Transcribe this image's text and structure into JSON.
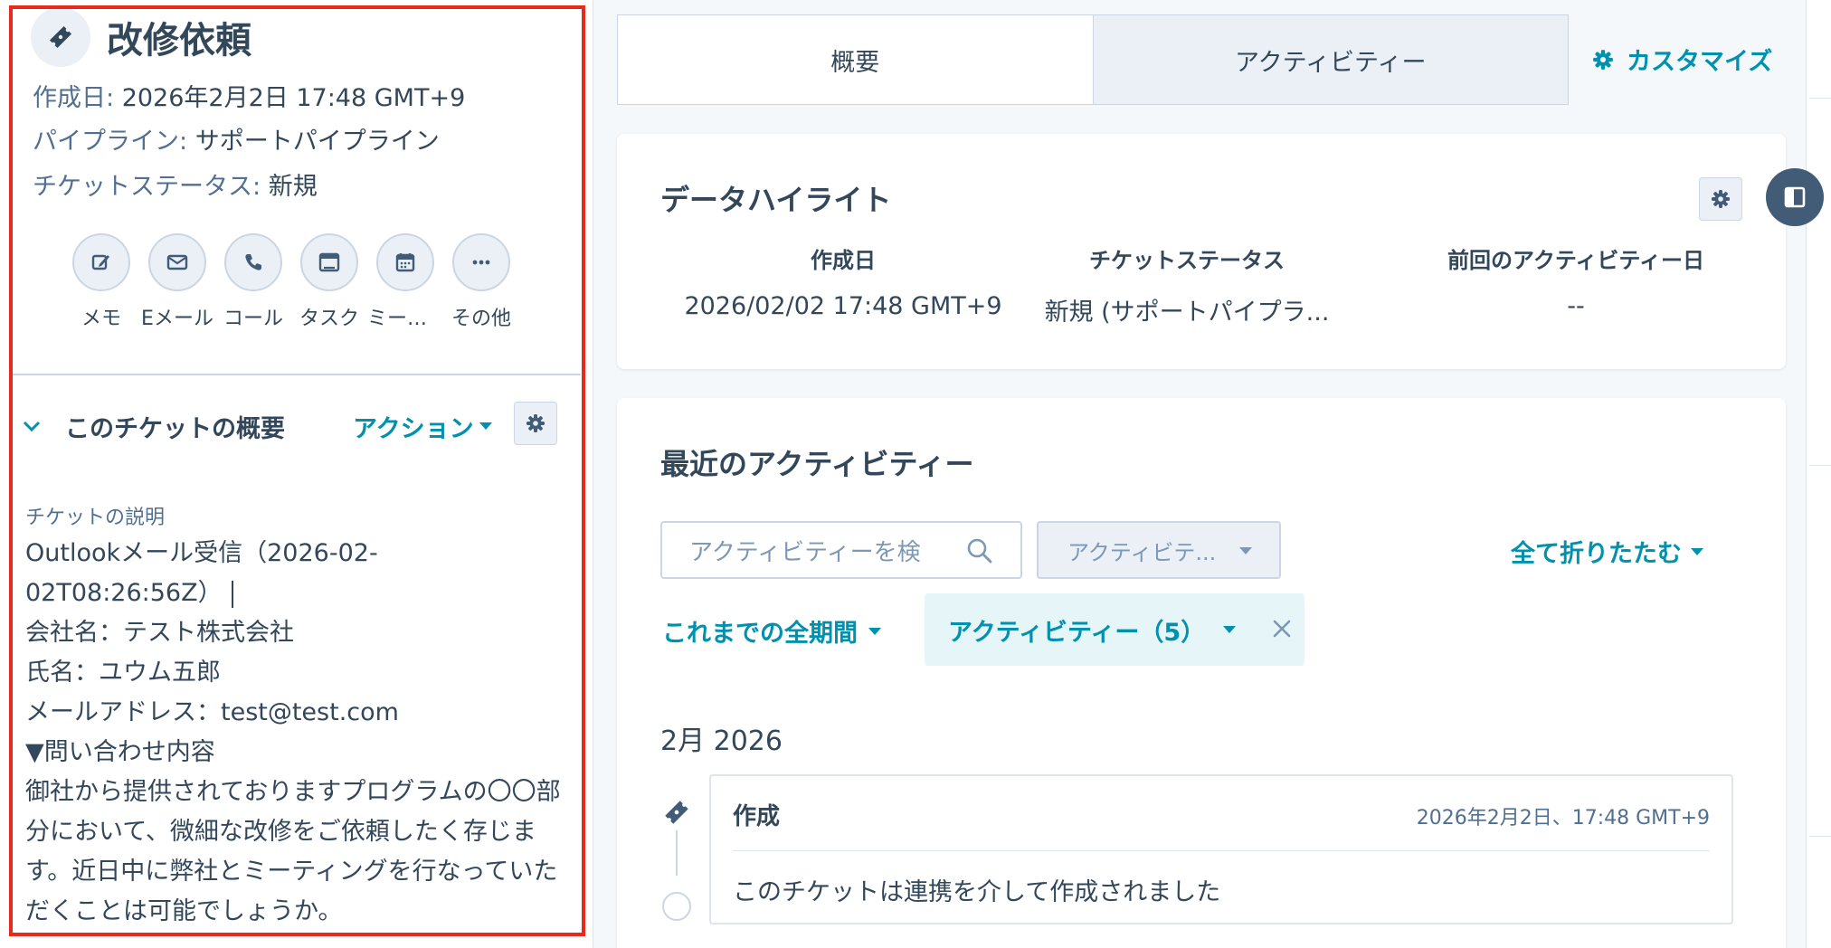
{
  "record": {
    "title": "改修依頼",
    "icon": "ticket-icon",
    "created_label": "作成日:",
    "created_value": "2026年2月2日 17:48 GMT+9",
    "pipeline_label": "パイプライン:",
    "pipeline_value": "サポートパイプライン",
    "status_label": "チケットステータス:",
    "status_value": "新規"
  },
  "quick_actions": [
    {
      "label": "メモ",
      "icon": "edit-icon"
    },
    {
      "label": "Eメール",
      "icon": "email-icon"
    },
    {
      "label": "コール",
      "icon": "phone-icon"
    },
    {
      "label": "タスク",
      "icon": "task-icon"
    },
    {
      "label": "ミーティング",
      "icon": "calendar-icon"
    },
    {
      "label": "その他",
      "icon": "more-icon"
    }
  ],
  "about": {
    "title": "このチケットの概要",
    "actions_label": "アクション",
    "description_label": "チケットの説明",
    "description_lines": [
      "Outlookメール受信（2026-02-",
      "02T08:26:56Z）",
      "会社名：テスト株式会社",
      "氏名：ユウム五郎",
      "メールアドレス：test@test.com",
      "▼問い合わせ内容",
      "御社から提供されておりますプログラムの〇〇部分において、微細な改修をご依頼したく存じます。近日中に弊社とミーティングを行なっていただくことは可能でしょうか。"
    ]
  },
  "tabs": [
    {
      "label": "概要",
      "active": true
    },
    {
      "label": "アクティビティー",
      "active": false
    }
  ],
  "customize_label": "カスタマイズ",
  "highlights": {
    "title": "データハイライト",
    "items": [
      {
        "label": "作成日",
        "value": "2026/02/02 17:48 GMT+9"
      },
      {
        "label": "チケットステータス",
        "value": "新規 (サポートパイプラ..."
      },
      {
        "label": "前回のアクティビティー日",
        "value": "--"
      }
    ]
  },
  "recent": {
    "title": "最近のアクティビティー",
    "search_placeholder": "アクティビティーを検",
    "type_select_value": "アクティビテ...",
    "collapse_all_label": "全て折りたたむ",
    "period_label": "これまでの全期間",
    "filter_chip_label": "アクティビティー（5）",
    "month_label": "2月 2026",
    "entry": {
      "title": "作成",
      "time": "2026年2月2日、17:48 GMT+9",
      "body": "このチケットは連携を介して作成されました"
    }
  },
  "colors": {
    "accent": "#0091ae",
    "text": "#33475b",
    "highlight_frame": "#e8291c"
  }
}
